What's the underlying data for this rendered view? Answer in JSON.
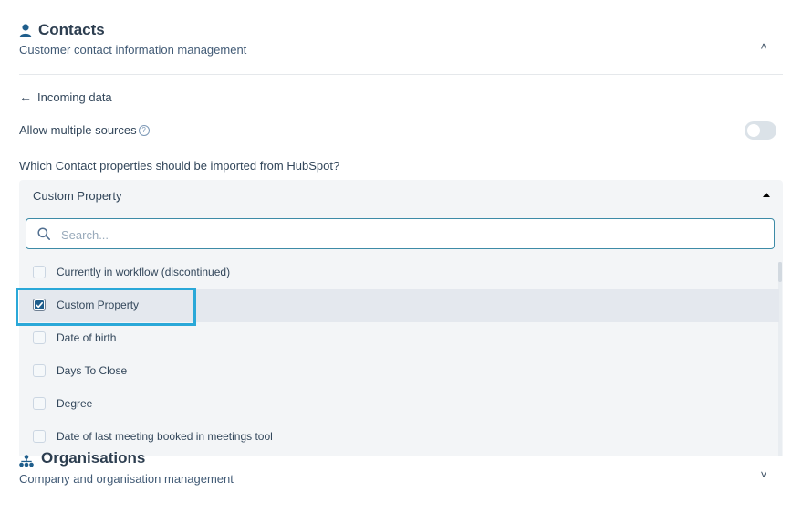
{
  "contacts_section": {
    "title": "Contacts",
    "icon": "person-icon",
    "subtitle": "Customer contact information management",
    "collapse_glyph": "˄"
  },
  "back_link": {
    "arrow": "←",
    "label": "Incoming data"
  },
  "multiple_sources": {
    "label": "Allow multiple sources",
    "help_glyph": "?",
    "enabled": false
  },
  "question": "Which Contact properties should be imported from HubSpot?",
  "select": {
    "value": "Custom Property",
    "expanded": true,
    "search_placeholder": "Search..."
  },
  "options": [
    {
      "label": "Currently in workflow (discontinued)",
      "checked": false
    },
    {
      "label": "Custom Property",
      "checked": true
    },
    {
      "label": "Date of birth",
      "checked": false
    },
    {
      "label": "Days To Close",
      "checked": false
    },
    {
      "label": "Degree",
      "checked": false
    },
    {
      "label": "Date of last meeting booked in meetings tool",
      "checked": false
    }
  ],
  "organisations_section": {
    "title": "Organisations",
    "icon": "org-chart-icon",
    "subtitle": "Company and organisation management",
    "expand_glyph": "˅"
  },
  "colors": {
    "accent": "#2aa8d8",
    "search_border": "#3d8ba7",
    "dropdown_bg": "#f3f5f7",
    "selected_row_bg": "#e4e8ee",
    "icon_blue": "#1f5e8c"
  }
}
